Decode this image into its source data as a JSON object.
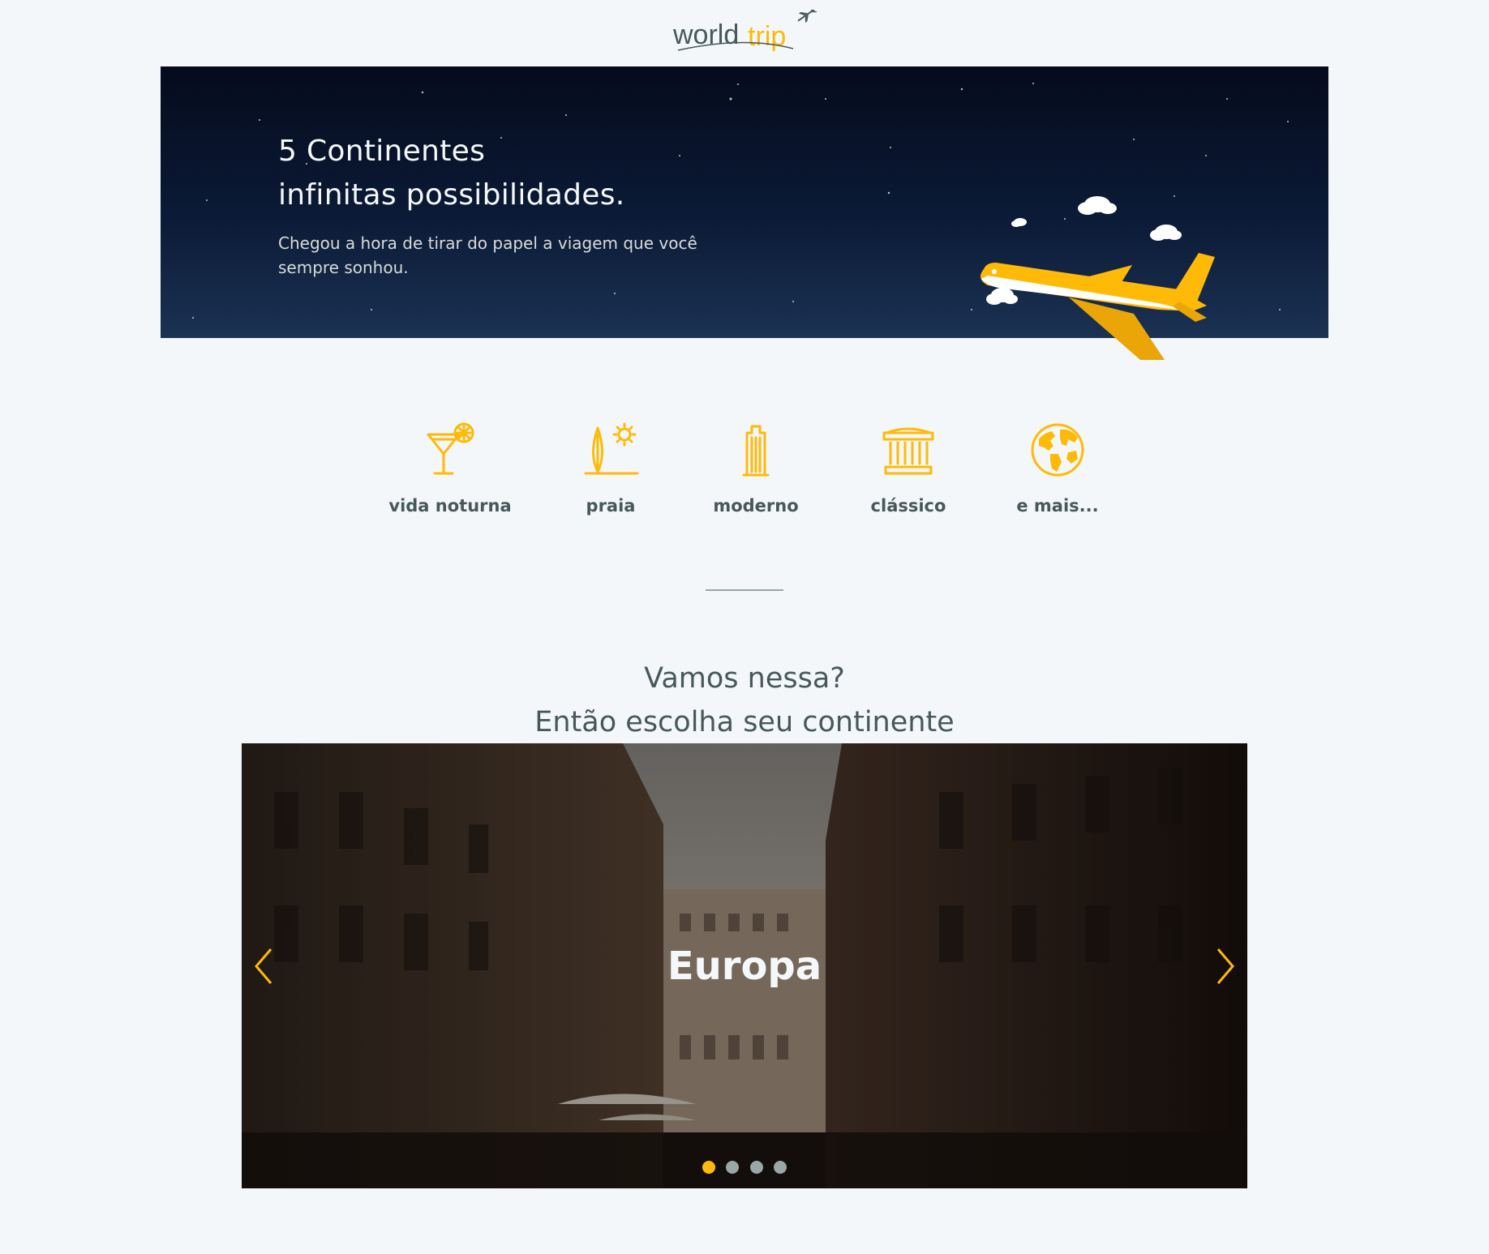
{
  "brand": {
    "logo_part1": "world",
    "logo_part2": "trip",
    "accent_color": "#ffba08",
    "text_color": "#47585b"
  },
  "banner": {
    "title_line1": "5 Continentes",
    "title_line2": "infinitas possibilidades.",
    "subtitle": "Chegou a hora de tirar do papel a viagem que você sempre sonhou.",
    "illustration": "airplane-icon"
  },
  "travel_types": [
    {
      "label": "vida noturna",
      "icon": "cocktail-icon"
    },
    {
      "label": "praia",
      "icon": "surf-sun-icon"
    },
    {
      "label": "moderno",
      "icon": "building-icon"
    },
    {
      "label": "clássico",
      "icon": "museum-icon"
    },
    {
      "label": "e mais...",
      "icon": "globe-icon"
    }
  ],
  "cta": {
    "line1": "Vamos nessa?",
    "line2": "Então escolha seu continente"
  },
  "slider": {
    "active_title": "Europa",
    "prev_icon": "chevron-left-icon",
    "next_icon": "chevron-right-icon",
    "total_slides": 4,
    "active_index": 0
  }
}
